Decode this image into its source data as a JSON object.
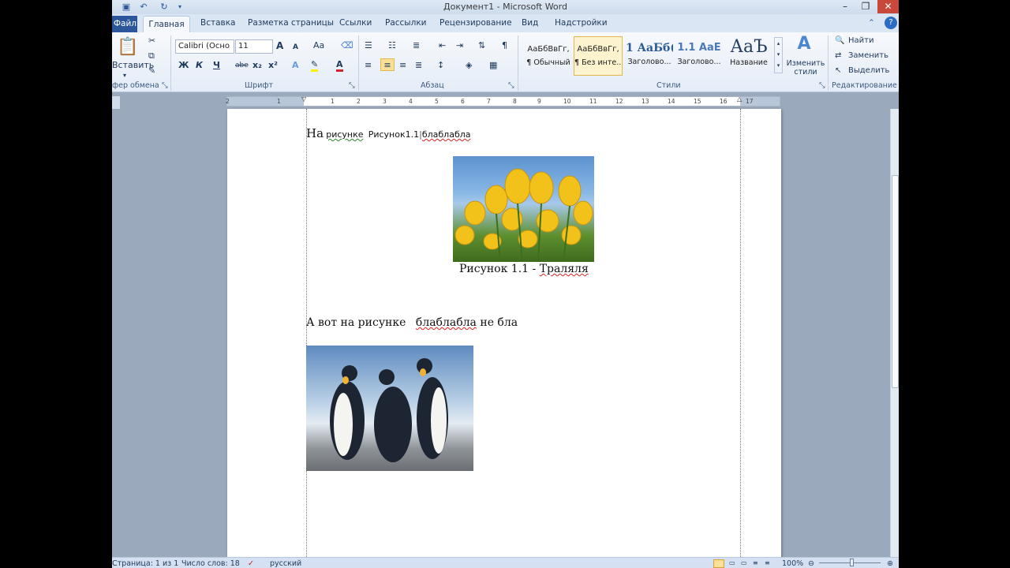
{
  "window": {
    "title": "Документ1  -  Microsoft Word"
  },
  "tabs": {
    "file": "Файл",
    "items": [
      "Главная",
      "Вставка",
      "Разметка страницы",
      "Ссылки",
      "Рассылки",
      "Рецензирование",
      "Вид",
      "Надстройки"
    ]
  },
  "ribbon": {
    "clipboard": {
      "paste": "Вставить",
      "label": "фер обмена"
    },
    "font": {
      "name": "Calibri (Осно",
      "size": "11",
      "bold": "Ж",
      "italic": "К",
      "underline": "Ч",
      "strike": "abe",
      "sub": "x₂",
      "sup": "x²",
      "label": "Шрифт",
      "grow": "A",
      "shrink": "A",
      "case": "Aa"
    },
    "paragraph": {
      "label": "Абзац"
    },
    "styles": {
      "label": "Стили",
      "items": [
        {
          "preview": "АаБбВвГг,",
          "name": "¶ Обычный"
        },
        {
          "preview": "АаБбВвГг,",
          "name": "¶ Без инте..."
        },
        {
          "preview": "1 АаБб(",
          "name": "Заголово..."
        },
        {
          "preview": "1.1 АаЕ",
          "name": "Заголово..."
        },
        {
          "preview": "АаЪ",
          "name": "Название"
        }
      ],
      "change": "Изменить стили"
    },
    "editing": {
      "find": "Найти",
      "replace": "Заменить",
      "select": "Выделить",
      "label": "Редактирование"
    }
  },
  "ruler": {
    "ticks": [
      "2",
      "1",
      "1",
      "2",
      "3",
      "4",
      "5",
      "6",
      "7",
      "8",
      "9",
      "10",
      "11",
      "12",
      "13",
      "14",
      "15",
      "16",
      "17"
    ]
  },
  "document": {
    "line1": {
      "a": "На",
      "b": "рисунке",
      "c": "Рисунок1.1",
      "d": "блаблабла"
    },
    "caption": {
      "a": "Рисунок 1.1 - ",
      "b": "Траляля"
    },
    "line2": {
      "a": "А вот на рисунке",
      "b": "блаблабла",
      "c": "не бла"
    }
  },
  "status": {
    "page": "Страница: 1 из 1",
    "words": "Число слов: 18",
    "lang": "русский",
    "zoom": "100%"
  }
}
